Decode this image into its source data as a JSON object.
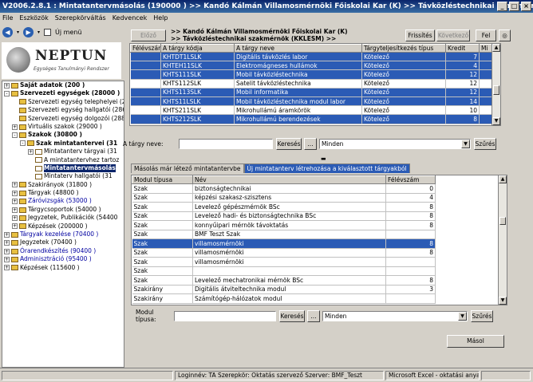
{
  "window": {
    "title": "V2006.2.8.1 : Mintatantervmásolás (190000 )  >> Kandó Kálmán Villamosmérnöki Főiskolai Kar (K) >> Távközléstechnikai szakmérnök (KKLESM) >> ..."
  },
  "menu": [
    "File",
    "Eszközök",
    "Szerepkörváltás",
    "Kedvencek",
    "Help"
  ],
  "toolbar": {
    "new_menu_label": "Új menü"
  },
  "logo": {
    "name": "NEPTUN",
    "subtitle": "Egységes Tanulmányi Rendszer"
  },
  "tree": [
    {
      "label": "Saját adatok (200 )",
      "indent": 0,
      "exp": "+",
      "bold": true
    },
    {
      "label": "Szervezeti egységek (28000 )",
      "indent": 0,
      "exp": "-",
      "bold": true
    },
    {
      "label": "Szervezeti egység telephelyei (2",
      "indent": 1,
      "exp": ""
    },
    {
      "label": "Szervezeti egység hallgatói (286",
      "indent": 1,
      "exp": ""
    },
    {
      "label": "Szervezeti egység dolgozói (288",
      "indent": 1,
      "exp": ""
    },
    {
      "label": "Virtuális szakok (29000 )",
      "indent": 1,
      "exp": "+"
    },
    {
      "label": "Szakok (30800 )",
      "indent": 1,
      "exp": "-",
      "bold": true
    },
    {
      "label": "Szak mintatantervei (31",
      "indent": 2,
      "exp": "-",
      "bold": true
    },
    {
      "label": "Mintatanterv tárgyai (31",
      "indent": 3,
      "exp": "+"
    },
    {
      "label": "A mintatantervhez tartoz",
      "indent": 3,
      "exp": ""
    },
    {
      "label": "Mintatantervmásolás",
      "indent": 3,
      "exp": "",
      "selected": true
    },
    {
      "label": "Mintaterv hallgatói (31",
      "indent": 3,
      "exp": ""
    },
    {
      "label": "Szakirányok (31800 )",
      "indent": 1,
      "exp": "+"
    },
    {
      "label": "Tárgyak (48800 )",
      "indent": 1,
      "exp": "+"
    },
    {
      "label": "Záróvizsgák (53000 )",
      "indent": 1,
      "exp": "+",
      "blue": true
    },
    {
      "label": "Tárgycsoportok (54000 )",
      "indent": 1,
      "exp": "+"
    },
    {
      "label": "Jegyzetek, Publikációk (54400",
      "indent": 1,
      "exp": "+"
    },
    {
      "label": "Képzések (200000 )",
      "indent": 1,
      "exp": "+"
    },
    {
      "label": "Tárgyak kezelése (70400 )",
      "indent": 0,
      "exp": "+",
      "blue": true
    },
    {
      "label": "Jegyzetek (70400 )",
      "indent": 0,
      "exp": "+"
    },
    {
      "label": "Órarendkészítés (90400 )",
      "indent": 0,
      "exp": "+",
      "blue": true
    },
    {
      "label": "Adminisztráció (95400 )",
      "indent": 0,
      "exp": "+",
      "blue": true
    },
    {
      "label": "Képzések (115600 )",
      "indent": 0,
      "exp": "+"
    }
  ],
  "topbar": {
    "prev_button": "Előző",
    "breadcrumb": ">> Kandó Kálmán Villamosmérnöki Főiskolai Kar (K) >> Távközléstechnikai szakmérnök (KKLESM) >> Távközléstechnikai szakmérnök",
    "refresh_button": "Frissítés",
    "next_button": "Következő",
    "up_button": "Fel"
  },
  "subjects_table": {
    "headers": [
      "Félévszám",
      "A tárgy kódja",
      "A tárgy neve",
      "Tárgyteljesítkezés típus",
      "Kredit",
      "Mi"
    ],
    "rows": [
      {
        "sem": "",
        "code": "KHTDT1LSLK",
        "name": "Digitális távközlés labor",
        "type": "Kötelező",
        "credit": "7",
        "hl": true
      },
      {
        "sem": "",
        "code": "KHTEH11SLK",
        "name": "Elektromágneses hullámok",
        "type": "Kötelező",
        "credit": "4",
        "hl": true
      },
      {
        "sem": "",
        "code": "KHTS111SLK",
        "name": "Mobil távközléstechnika",
        "type": "Kötelező",
        "credit": "12",
        "hl": true
      },
      {
        "sem": "",
        "code": "KHTS112SLK",
        "name": "Satelit távközléstechnika",
        "type": "Kötelező",
        "credit": "12",
        "hl": false
      },
      {
        "sem": "",
        "code": "KHTS113SLK",
        "name": "Mobil informatika",
        "type": "Kötelező",
        "credit": "12",
        "hl": true
      },
      {
        "sem": "",
        "code": "KHTS11LSLK",
        "name": "Mobil távközléstechnika modul labor",
        "type": "Kötelező",
        "credit": "14",
        "hl": true
      },
      {
        "sem": "",
        "code": "KHTS211SLK",
        "name": "Mikrohullámú áramkörök",
        "type": "Kötelező",
        "credit": "10",
        "hl": false
      },
      {
        "sem": "",
        "code": "KHTS212SLK",
        "name": "Mikrohullámú berendezések",
        "type": "Kötelező",
        "credit": "8",
        "hl": true
      }
    ]
  },
  "filter1": {
    "label": "A tárgy neve:",
    "input_value": "",
    "search_button": "Keresés",
    "dots_button": "...",
    "select_value": "Minden",
    "filter_button": "Szűrés"
  },
  "tabs": [
    "Másolás már létező mintatantervbe",
    "Új mintatanterv létrehozása a kiválasztott tárgyakból"
  ],
  "modules_table": {
    "headers": [
      "Modul típusa",
      "Név",
      "Félévszám"
    ],
    "rows": [
      {
        "type": "Szak",
        "name": "biztonságtechnikai",
        "sem": "0",
        "hl": false
      },
      {
        "type": "Szak",
        "name": "képzési szakasz-szisztens",
        "sem": "4",
        "hl": false
      },
      {
        "type": "Szak",
        "name": "Levelező gépészmérnök BSc",
        "sem": "8",
        "hl": false
      },
      {
        "type": "Szak",
        "name": "Levelező hadi- és biztonságtechnika BSc",
        "sem": "8",
        "hl": false
      },
      {
        "type": "Szak",
        "name": "konnyűipari mérnök távoktatás",
        "sem": "8",
        "hl": false
      },
      {
        "type": "Szak",
        "name": "BMF Teszt Szak",
        "sem": "",
        "hl": false
      },
      {
        "type": "Szak",
        "name": "villamosmérnöki",
        "sem": "8",
        "hl": true
      },
      {
        "type": "Szak",
        "name": "villamosmérnöki",
        "sem": "8",
        "hl": false
      },
      {
        "type": "Szak",
        "name": "villamosmérnöki",
        "sem": "",
        "hl": false
      },
      {
        "type": "Szak",
        "name": "",
        "sem": "",
        "hl": false
      },
      {
        "type": "Szak",
        "name": "Levelező mechatronikai mérnök BSc",
        "sem": "8",
        "hl": false
      },
      {
        "type": "Szakirány",
        "name": "Digitális átviteltechnika modul",
        "sem": "3",
        "hl": false
      },
      {
        "type": "Szakirány",
        "name": "Számítógép-hálózatok modul",
        "sem": "",
        "hl": false
      }
    ]
  },
  "filter2": {
    "label": "Modul típusa:",
    "input_value": "",
    "search_button": "Keresés",
    "dots_button": "...",
    "select_value": "Minden",
    "filter_button": "Szűrés"
  },
  "copy_button": "Másol",
  "statusbar": {
    "login": "Loginnév: TA  Szerepkör: Oktatás szervező  Szerver: BMF_Teszt",
    "task": "Microsoft Excel - oktatási anyagok"
  }
}
